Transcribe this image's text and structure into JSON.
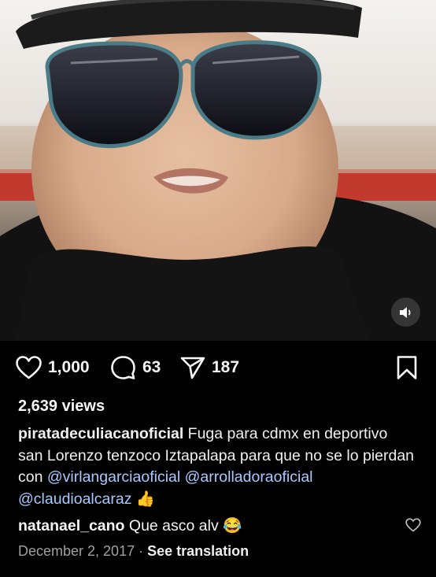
{
  "post": {
    "likes": "1,000",
    "comments": "63",
    "shares": "187",
    "views": "2,639 views",
    "caption_user": "piratadeculiacanoficial",
    "caption_text": " Fuga para cdmx en deportivo san Lorenzo tenzoco Iztapalapa para que no se lo pierdan con ",
    "mention_1": "@virlangarciaoficial",
    "mention_2": "@arrolladoraoficial",
    "mention_3": "@claudioalcaraz",
    "caption_emoji": "👍"
  },
  "comment": {
    "user": "natanael_cano",
    "text": " Que asco alv ",
    "emoji": "😂"
  },
  "meta": {
    "date": "December 2, 2017",
    "separator": " · ",
    "translate": "See translation"
  },
  "icons": {
    "like": "heart-outline-icon",
    "comment": "comment-bubble-icon",
    "share": "paper-plane-icon",
    "save": "bookmark-icon",
    "mute": "speaker-icon"
  }
}
